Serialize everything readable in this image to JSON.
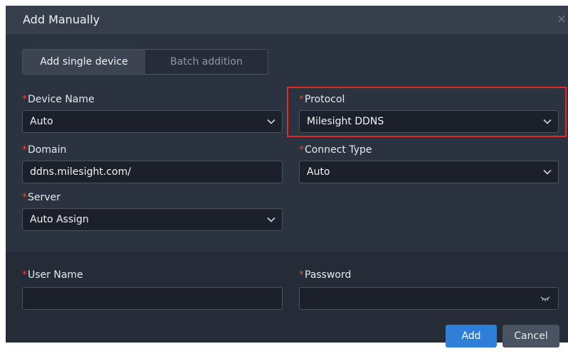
{
  "dialog": {
    "title": "Add Manually",
    "close_glyph": "×"
  },
  "tabs": [
    {
      "label": "Add single device",
      "active": true
    },
    {
      "label": "Batch addition",
      "active": false
    }
  ],
  "form": {
    "required_mark": "*",
    "device_name": {
      "label": "Device Name",
      "value": "Auto"
    },
    "protocol": {
      "label": "Protocol",
      "value": "Milesight DDNS"
    },
    "domain": {
      "label": "Domain",
      "value": "ddns.milesight.com/"
    },
    "connect_type": {
      "label": "Connect Type",
      "value": "Auto"
    },
    "server": {
      "label": "Server",
      "value": "Auto Assign"
    },
    "user_name": {
      "label": "User Name",
      "value": ""
    },
    "password": {
      "label": "Password",
      "value": ""
    }
  },
  "actions": {
    "add_label": "Add",
    "cancel_label": "Cancel"
  },
  "colors": {
    "accent": "#2f7ed8",
    "required": "#e0443a",
    "highlight": "#e02b24",
    "background": "#2b3340"
  },
  "icons": [
    "close-icon",
    "chevron-down-icon",
    "eye-closed-icon"
  ]
}
